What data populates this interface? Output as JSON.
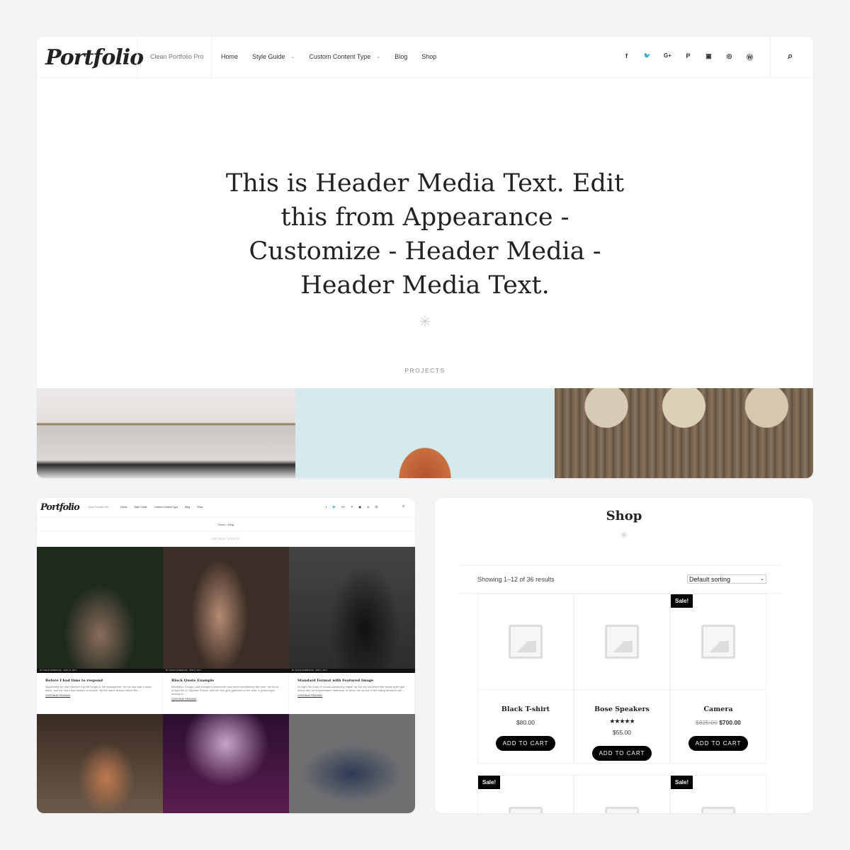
{
  "site": {
    "logo": "Portfolio",
    "tagline": "Clean Portfolio Pro"
  },
  "nav": [
    {
      "label": "Home"
    },
    {
      "label": "Style Guide",
      "dropdown": true
    },
    {
      "label": "Custom Content Type",
      "dropdown": true
    },
    {
      "label": "Blog"
    },
    {
      "label": "Shop"
    }
  ],
  "social": [
    {
      "icon": "facebook-icon",
      "glyph": "f"
    },
    {
      "icon": "twitter-icon",
      "glyph": "🐦"
    },
    {
      "icon": "google-plus-icon",
      "glyph": "G+"
    },
    {
      "icon": "pinterest-icon",
      "glyph": "P"
    },
    {
      "icon": "youtube-icon",
      "glyph": "▣"
    },
    {
      "icon": "instagram-icon",
      "glyph": "◎"
    },
    {
      "icon": "wordpress-icon",
      "glyph": "Ⓦ"
    }
  ],
  "search_icon": "⌕",
  "hero": {
    "text": "This is Header Media Text. Edit this from Appearance - Customize - Header Media - Header Media Text.",
    "section_label": "PROJECTS"
  },
  "blog": {
    "breadcrumb": "Home › Blog",
    "section_label": "RECENT POSTS",
    "posts": [
      {
        "author": "BY SAKHI SHRESTHA",
        "date": "MAR 12, 2017",
        "title": "Before I had time to respond",
        "excerpt": "Apparently we had reached a great height in the atmosphere, for the sky was a dead black, and the stars had ceased to twinkle. By the same illusion which lifts ...",
        "more": "CONTINUE READING"
      },
      {
        "author": "BY SAKHI SHRESTHA",
        "date": "APR 6, 2017",
        "title": "Block Quote Example",
        "excerpt": "Meantime Giorgio, with tranquil movements, had been unfastening the door; the flood of light fell on Signora Teresa, with her two girls gathered to her side, a picturesque woman in ...",
        "more": "CONTINUE READING"
      },
      {
        "author": "BY SAKHI SHRESTHA",
        "date": "APR 6, 2017",
        "title": "Standard Format with Featured Image",
        "excerpt": "At night the body of clouds advancing higher up the sky smothers the whole quiet gulf below with an impenetrable darkness, in which the sound of the falling showers can ...",
        "more": "CONTINUE READING"
      }
    ]
  },
  "shop": {
    "title": "Shop",
    "result_count": "Showing 1–12 of 36 results",
    "sorting": "Default sorting",
    "sale_label": "Sale!",
    "cart_label": "ADD TO CART",
    "products": [
      {
        "name": "Black T-shirt",
        "price": "$80.00",
        "sale": false
      },
      {
        "name": "Bose Speakers",
        "price": "$55.00",
        "rating": 5,
        "stars": "★★★★★",
        "sale": false
      },
      {
        "name": "Camera",
        "old_price": "$825.00",
        "price": "$700.00",
        "sale": true
      }
    ]
  }
}
